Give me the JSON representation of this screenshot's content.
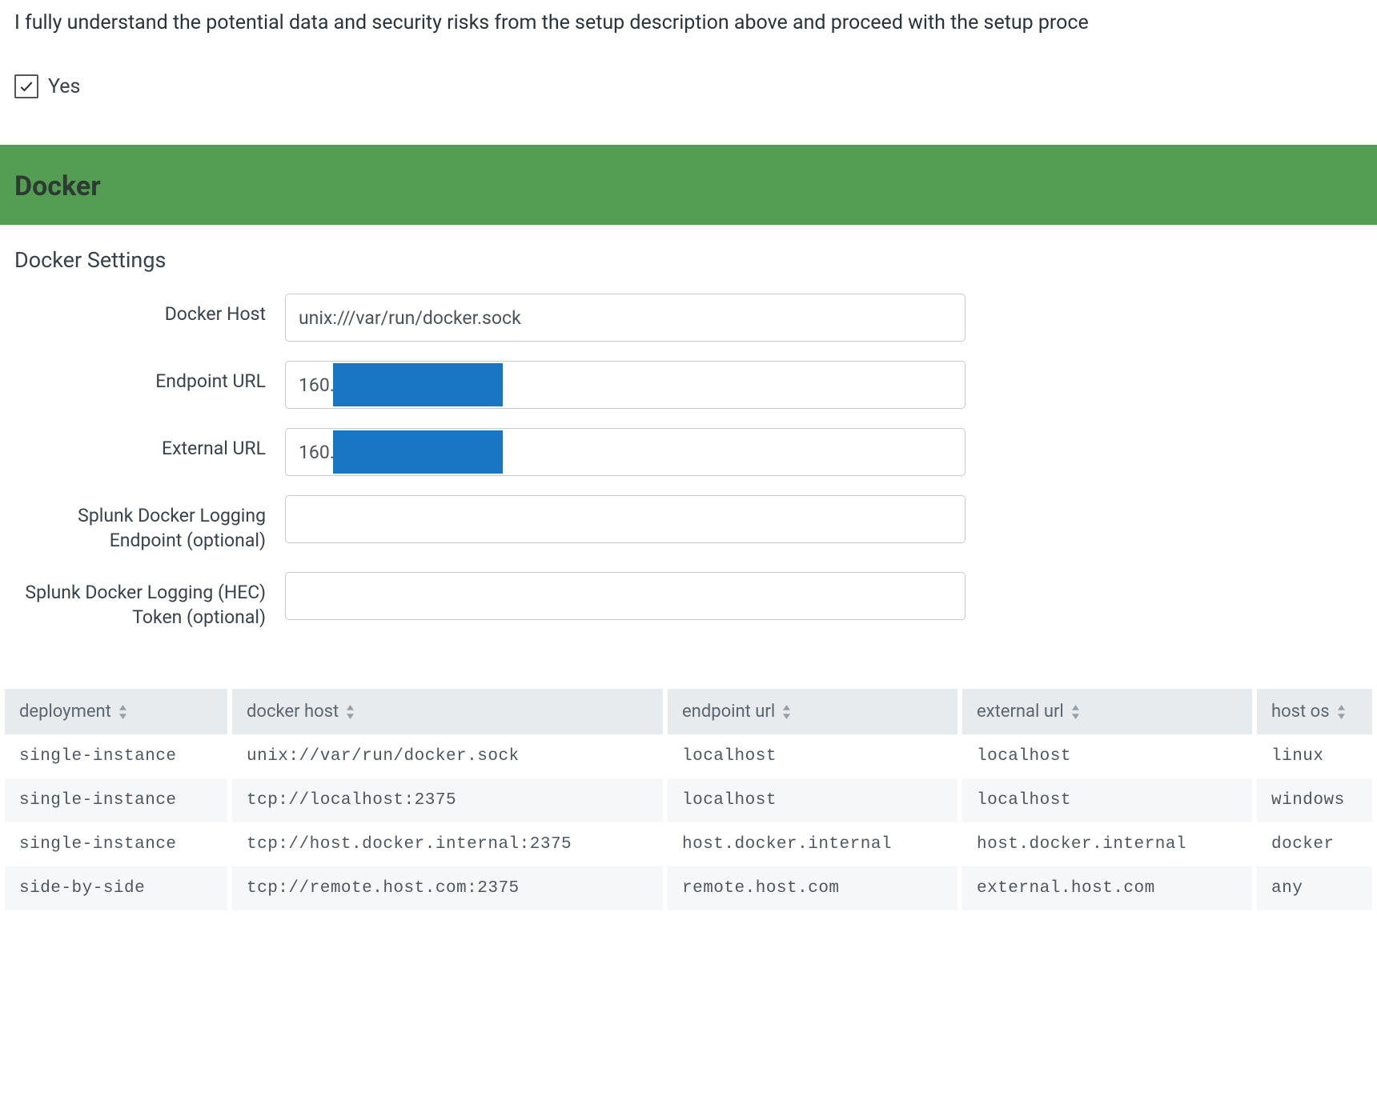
{
  "consent": {
    "text": "I fully understand the potential data and security risks from the setup description above and proceed with the setup proce",
    "checkbox_label": "Yes",
    "checked": true
  },
  "section": {
    "title": "Docker"
  },
  "settings": {
    "title": "Docker Settings",
    "fields": {
      "docker_host": {
        "label": "Docker Host",
        "value": "unix:///var/run/docker.sock"
      },
      "endpoint_url": {
        "label": "Endpoint URL",
        "value": "160."
      },
      "external_url": {
        "label": "External URL",
        "value": "160."
      },
      "splunk_endpoint": {
        "label": "Splunk Docker Logging Endpoint (optional)",
        "value": ""
      },
      "splunk_token": {
        "label": "Splunk Docker Logging (HEC) Token (optional)",
        "value": ""
      }
    }
  },
  "table": {
    "columns": [
      "deployment",
      "docker host",
      "endpoint url",
      "external url",
      "host os"
    ],
    "rows": [
      {
        "deployment": "single-instance",
        "docker_host": "unix://var/run/docker.sock",
        "endpoint_url": "localhost",
        "external_url": "localhost",
        "host_os": "linux"
      },
      {
        "deployment": "single-instance",
        "docker_host": "tcp://localhost:2375",
        "endpoint_url": "localhost",
        "external_url": "localhost",
        "host_os": "windows"
      },
      {
        "deployment": "single-instance",
        "docker_host": "tcp://host.docker.internal:2375",
        "endpoint_url": "host.docker.internal",
        "external_url": "host.docker.internal",
        "host_os": "docker"
      },
      {
        "deployment": "side-by-side",
        "docker_host": "tcp://remote.host.com:2375",
        "endpoint_url": "remote.host.com",
        "external_url": "external.host.com",
        "host_os": "any"
      }
    ]
  }
}
